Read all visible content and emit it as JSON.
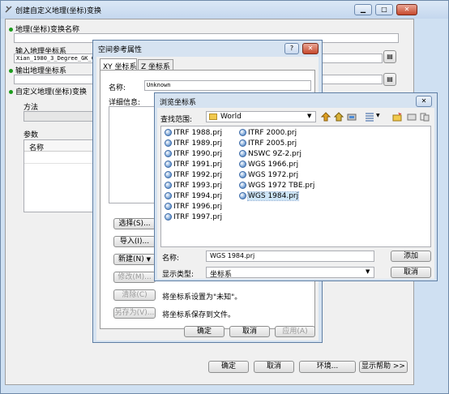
{
  "main_window": {
    "title": "创建自定义地理(坐标)变换",
    "geo_name_label": "地理(坐标)变换名称",
    "input_gcs_label": "输入地理坐标系",
    "input_gcs_value": "Xian_1980_3_Degree_GK_C",
    "output_gcs_label": "输出地理坐标系",
    "custom_transform_label": "自定义地理(坐标)变换",
    "method_label": "方法",
    "params_label": "参数",
    "params_col_name": "名称",
    "buttons": {
      "ok": "确定",
      "cancel": "取消",
      "env": "环境...",
      "help": "显示帮助 >>"
    }
  },
  "spatial_ref": {
    "title": "空间参考属性",
    "tabs": [
      "XY 坐标系",
      "Z 坐标系"
    ],
    "name_label": "名称:",
    "name_value": "Unknown",
    "details_label": "详细信息:",
    "side_buttons": [
      "选择(S)...",
      "导入(I)...",
      "新建(N)",
      "修改(M)...",
      "清除(C)",
      "另存为(V)..."
    ],
    "clear_desc": "将坐标系设置为\"未知\"。",
    "save_desc": "将坐标系保存到文件。",
    "buttons": {
      "ok": "确定",
      "cancel": "取消",
      "apply": "应用(A)"
    }
  },
  "browse": {
    "title": "浏览坐标系",
    "lookin_label": "查找范围:",
    "lookin_value": "World",
    "files_col1": [
      "ITRF 1988.prj",
      "ITRF 1989.prj",
      "ITRF 1990.prj",
      "ITRF 1991.prj",
      "ITRF 1992.prj",
      "ITRF 1993.prj",
      "ITRF 1994.prj",
      "ITRF 1996.prj",
      "ITRF 1997.prj"
    ],
    "files_col2": [
      "ITRF 2000.prj",
      "ITRF 2005.prj",
      "NSWC 9Z-2.prj",
      "WGS 1966.prj",
      "WGS 1972.prj",
      "WGS 1972 TBE.prj",
      "WGS 1984.prj"
    ],
    "name_label": "名称:",
    "name_value": "WGS 1984.prj",
    "type_label": "显示类型:",
    "type_value": "坐标系",
    "buttons": {
      "add": "添加",
      "cancel": "取消"
    }
  },
  "colors": {
    "accent": "#1e9c1e",
    "selection": "#cde5f7"
  }
}
